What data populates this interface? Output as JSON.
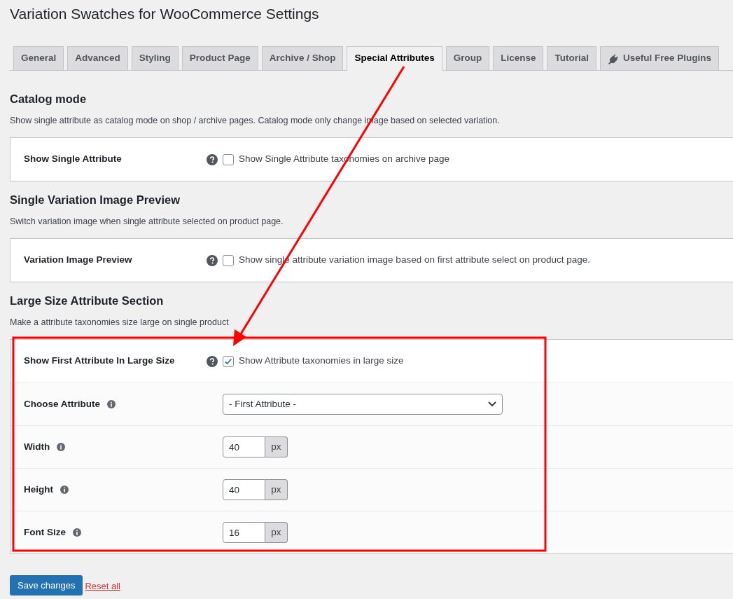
{
  "page_title": "Variation Swatches for WooCommerce Settings",
  "tabs": [
    {
      "label": "General",
      "selected": false,
      "kind": "plain"
    },
    {
      "label": "Advanced",
      "selected": false,
      "kind": "plain"
    },
    {
      "label": "Styling",
      "selected": false,
      "kind": "plain"
    },
    {
      "label": "Product Page",
      "selected": false,
      "kind": "plain"
    },
    {
      "label": "Archive / Shop",
      "selected": false,
      "kind": "plain"
    },
    {
      "label": "Special Attributes",
      "selected": true,
      "kind": "plain"
    },
    {
      "label": "Group",
      "selected": false,
      "kind": "plain"
    },
    {
      "label": "License",
      "selected": false,
      "kind": "plain"
    },
    {
      "label": "Tutorial",
      "selected": false,
      "kind": "plain"
    },
    {
      "label": "Useful Free Plugins",
      "selected": false,
      "kind": "icon"
    }
  ],
  "sections": [
    {
      "title": "Catalog mode",
      "description": "Show single attribute as catalog mode on shop / archive pages. Catalog mode only change image based on selected variation.",
      "rows": [
        {
          "kind": "checkbox",
          "label": "Show Single Attribute",
          "checked": false,
          "text": "Show Single Attribute taxonomies on archive page"
        }
      ]
    },
    {
      "title": "Single Variation Image Preview",
      "description": "Switch variation image when single attribute selected on product page.",
      "rows": [
        {
          "kind": "checkbox",
          "label": "Variation Image Preview",
          "checked": false,
          "text": "Show single attribute variation image based on first attribute select on product page."
        }
      ]
    },
    {
      "title": "Large Size Attribute Section",
      "description": "Make a attribute taxonomies size large on single product",
      "rows": [
        {
          "kind": "checkbox",
          "label": "Show First Attribute In Large Size",
          "checked": true,
          "text": "Show Attribute taxonomies in large size"
        },
        {
          "kind": "select",
          "label": "Choose Attribute",
          "value": "- First Attribute -"
        },
        {
          "kind": "number",
          "label": "Width",
          "value": "40",
          "unit": "px"
        },
        {
          "kind": "number",
          "label": "Height",
          "value": "40",
          "unit": "px"
        },
        {
          "kind": "number",
          "label": "Font Size",
          "value": "16",
          "unit": "px"
        }
      ]
    }
  ],
  "actions": {
    "save": "Save changes",
    "reset": "Reset all"
  }
}
